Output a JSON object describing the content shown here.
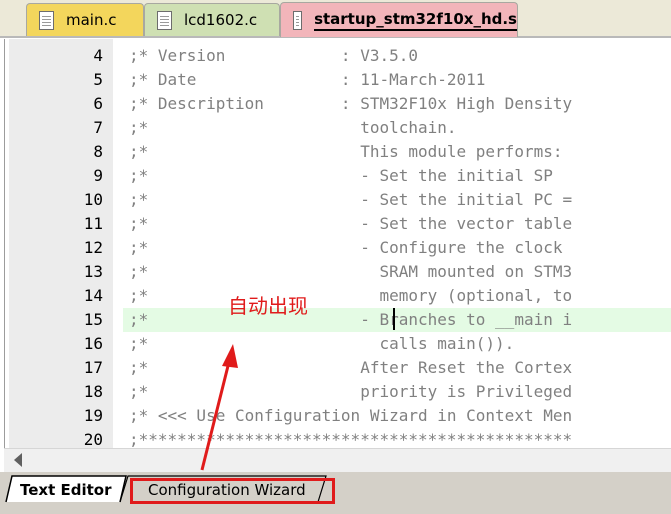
{
  "tabs": [
    {
      "label": "main.c"
    },
    {
      "label": "lcd1602.c"
    },
    {
      "label": "startup_stm32f10x_hd.s",
      "active": true
    }
  ],
  "editor": {
    "lines": [
      {
        "num": "4",
        "text": ";* Version            : V3.5.0"
      },
      {
        "num": "5",
        "text": ";* Date               : 11-March-2011"
      },
      {
        "num": "6",
        "text": ";* Description        : STM32F10x High Density"
      },
      {
        "num": "7",
        "text": ";*                      toolchain."
      },
      {
        "num": "8",
        "text": ";*                      This module performs:"
      },
      {
        "num": "9",
        "text": ";*                      - Set the initial SP"
      },
      {
        "num": "10",
        "text": ";*                      - Set the initial PC ="
      },
      {
        "num": "11",
        "text": ";*                      - Set the vector table"
      },
      {
        "num": "12",
        "text": ";*                      - Configure the clock"
      },
      {
        "num": "13",
        "text": ";*                        SRAM mounted on STM3"
      },
      {
        "num": "14",
        "text": ";*                        memory (optional, to"
      },
      {
        "num": "15",
        "text": ";*                      - Branches to __main i"
      },
      {
        "num": "16",
        "text": ";*                        calls main())."
      },
      {
        "num": "17",
        "text": ";*                      After Reset the Cortex"
      },
      {
        "num": "18",
        "text": ";*                      priority is Privileged"
      },
      {
        "num": "19",
        "text": ";* <<< Use Configuration Wizard in Context Men"
      },
      {
        "num": "20",
        "text": ";*********************************************"
      }
    ],
    "highlighted_line": "15"
  },
  "view_tabs": {
    "text_editor": "Text Editor",
    "configuration_wizard": "Configuration Wizard"
  },
  "annotation": {
    "text": "自动出现",
    "color": "#e01b1b"
  }
}
